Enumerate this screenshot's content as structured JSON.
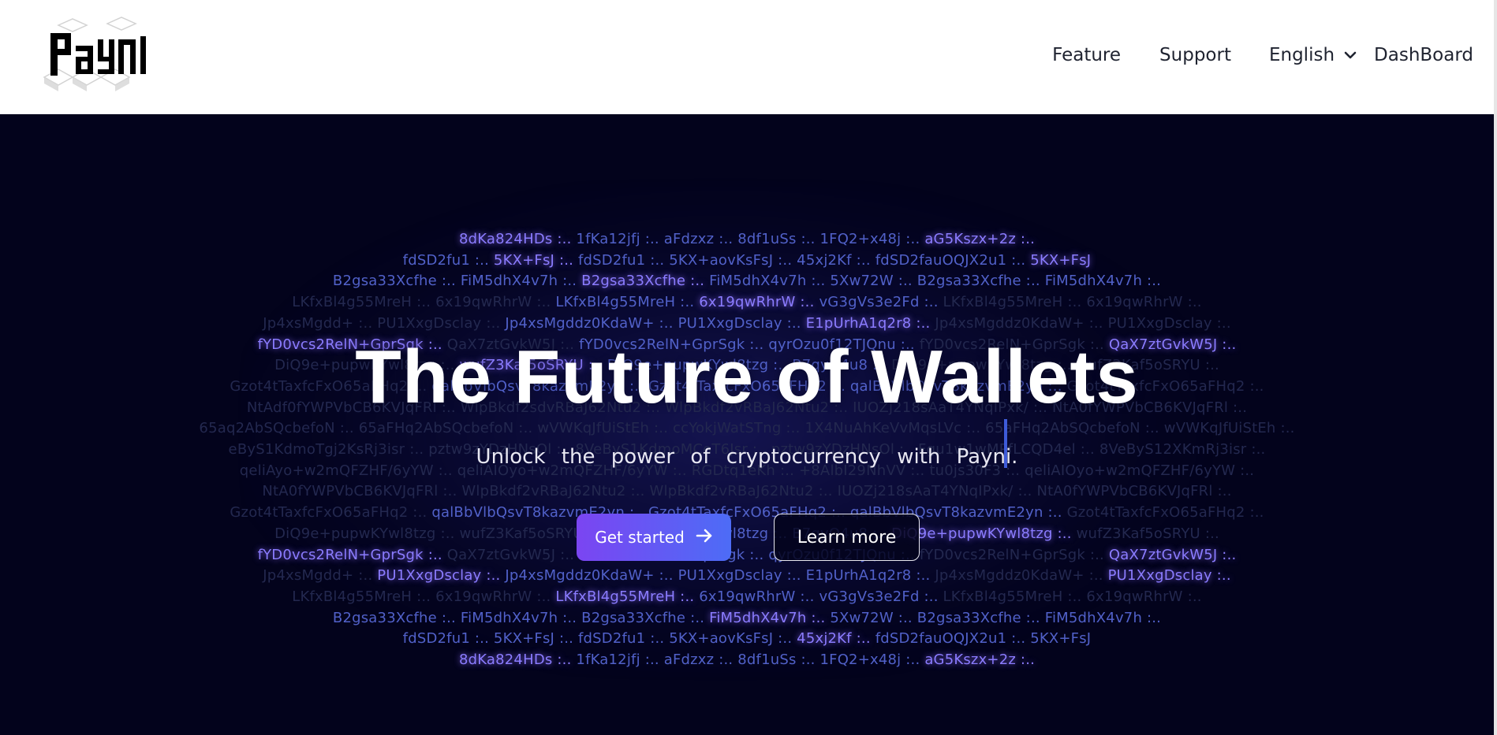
{
  "header": {
    "logo_text": "Payni",
    "nav": {
      "feature": "Feature",
      "support": "Support",
      "language": "English",
      "dashboard": "DashBoard"
    }
  },
  "hero": {
    "title": "The Future of Wallets",
    "subtitle": "Unlock the power of cryptocurrency with Payni.",
    "primary_button": "Get started",
    "secondary_button": "Learn more"
  },
  "code_rows": [
    "8dKa824HDs :.. 1fKa12jfj :.. aFdzxz :.. 8df1uSs :.. 1FQ2+x48j :.. aG5Kszx+2z :..",
    "fdSD2fu1 :.. 5KX+FsJ :.. fdSD2fu1 :.. 5KX+aovKsFsJ :.. 45xj2Kf :.. fdSD2fauOQJX2u1 :.. 5KX+FsJ",
    "B2gsa33Xcfhe :.. FiM5dhX4v7h :.. B2gsa33Xcfhe :.. FiM5dhX4v7h :.. 5Xw72W :.. B2gsa33Xcfhe :.. FiM5dhX4v7h :..",
    "LKfxBl4g55MreH :.. 6x19qwRhrW :.. LKfxBl4g55MreH :.. 6x19qwRhrW :.. vG3gVs3e2Fd :.. LKfxBl4g55MreH :.. 6x19qwRhrW :..",
    "Jp4xsMgdd+ :.. PU1XxgDsclay :.. Jp4xsMgddz0KdaW+ :.. PU1XxgDsclay :.. E1pUrhA1q2r8 :.. Jp4xsMgddz0KdaW+ :.. PU1XxgDsclay :..",
    "fYD0vcs2RelN+GprSgk :.. QaX7ztGvkW5J :.. fYD0vcs2RelN+GprSgk :.. qyrOzu0f12TJQnu :.. fYD0vcs2RelN+GprSgk :.. QaX7ztGvkW5J :..",
    "DiQ9e+pupwKYwl8tzg :.. wufZ3Kaf5oSRYU :.. DiQ9e+pupwKYwl8tzg :.. B7qyQ4u8 :.. DiQ9e+pupwKYwl8tzg :.. wufZ3Kaf5oSRYU :..",
    "Gzot4tTaxfcFxO65aFHq2 :.. qalBbVlbQsvT8kazvmE2yn :.. Gzot4tTaxfcFxO65aFHq2 :.. qalBbVlbQsvT8kazvmE2yn :.. Gzot4tTaxfcFxO65aFHq2 :..",
    "NtAdf0fYWPVbCB6KVJqFRl :.. WlpBkdf2sdvRBaJ62Ntu2 :.. WlpBkdf2vRBaJ62Ntu2 :.. IUOZj218sAaT4YNqIPxk/ :.. NtA0fYWPVbCB6KVJqFRl :..",
    "65aq2AbSQcbefoN :.. 65aFHq2AbSQcbefoN :.. wVWKqJfUiStEh :.. ccYokjWatSTng :.. 1X4NuAhKeVvMqsLVc :.. 65aFHq2AbSQcbefoN :.. wVWKqJfUiStEh :..",
    "eByS1KdmoTgj2KsRj3isr :.. pztw9zYDzHNsOl :.. 8VeByS1KdmoMCoT6Jsr :.. pztw9zYDzHNsOl :.. Fgu1w1wMPfLCQD4el :.. 8VeByS12XKmRj3isr :..",
    "qeliAyo+w2mQFZHF/6yYW :.. qeliAIOyo+w2mQFZHF/6yYW :.. RGDtq1eKh :.. +8AlbI29NhVV :.. tu0js30F3 :.. qeliAIOyo+w2mQFZHF/6yYW :..",
    "NtA0fYWPVbCB6KVJqFRl :.. WlpBkdf2vRBaJ62Ntu2 :.. WlpBkdf2vRBaJ62Ntu2 :.. IUOZj218sAaT4YNqIPxk/ :.. NtA0fYWPVbCB6KVJqFRl :..",
    "Gzot4tTaxfcFxO65aFHq2 :.. qalBbVlbQsvT8kazvmE2yn :.. Gzot4tTaxfcFxO65aFHq2 :.. qalBbVlbQsvT8kazvmE2yn :.. Gzot4tTaxfcFxO65aFHq2 :..",
    "DiQ9e+pupwKYwl8tzg :.. wufZ3Kaf5oSRYU :.. DiQ9e+pupwKYwl8tzg :.. B7qyQ4u8 :.. DiQ9e+pupwKYwl8tzg :.. wufZ3Kaf5oSRYU :..",
    "fYD0vcs2RelN+GprSgk :.. QaX7ztGvkW5J :.. fYD0vcs2RelN+GprSgk :.. qyrOzu0f12TJQnu :.. fYD0vcs2RelN+GprSgk :.. QaX7ztGvkW5J :..",
    "Jp4xsMgdd+ :.. PU1XxgDsclay :.. Jp4xsMgddz0KdaW+ :.. PU1XxgDsclay :.. E1pUrhA1q2r8 :.. Jp4xsMgddz0KdaW+ :.. PU1XxgDsclay :..",
    "LKfxBl4g55MreH :.. 6x19qwRhrW :.. LKfxBl4g55MreH :.. 6x19qwRhrW :.. vG3gVs3e2Fd :.. LKfxBl4g55MreH :.. 6x19qwRhrW :..",
    "B2gsa33Xcfhe :.. FiM5dhX4v7h :.. B2gsa33Xcfhe :.. FiM5dhX4v7h :.. 5Xw72W :.. B2gsa33Xcfhe :.. FiM5dhX4v7h :..",
    "fdSD2fu1 :.. 5KX+FsJ :.. fdSD2fu1 :.. 5KX+aovKsFsJ :.. 45xj2Kf :.. fdSD2fauOQJX2u1 :.. 5KX+FsJ",
    "8dKa824HDs :.. 1fKa12jfj :.. aFdzxz :.. 8df1uSs :.. 1FQ2+x48j :.. aG5Kszx+2z :.."
  ],
  "colors": {
    "hero_bg": "#03031c",
    "primary_gradient_start": "#7b45f2",
    "primary_gradient_end": "#4d6cf6",
    "nav_text": "#1f2330"
  },
  "icons": {
    "language_dropdown": "chevron-down-icon",
    "primary_button": "arrow-right-icon"
  }
}
